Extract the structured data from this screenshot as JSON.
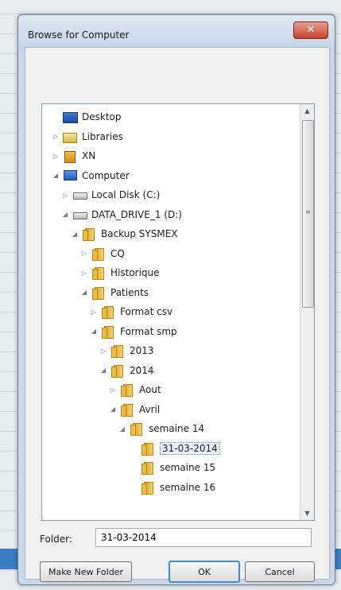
{
  "dialog": {
    "title": "Browse for Computer",
    "close_glyph": "✕",
    "folder_label": "Folder:",
    "folder_value": "31-03-2014",
    "buttons": {
      "new_folder": "Make New Folder",
      "ok": "OK",
      "cancel": "Cancel"
    }
  },
  "tree": [
    {
      "label": "Desktop",
      "icon": "desktop-icon",
      "toggle": ""
    },
    {
      "label": "Libraries",
      "icon": "libraries-icon",
      "toggle": "▷"
    },
    {
      "label": "XN",
      "icon": "user-icon",
      "toggle": "▷"
    },
    {
      "label": "Computer",
      "icon": "computer-icon",
      "toggle": "◢"
    },
    {
      "label": "Local Disk (C:)",
      "icon": "drive-icon",
      "toggle": "▷"
    },
    {
      "label": "DATA_DRIVE_1 (D:)",
      "icon": "drive-icon",
      "toggle": "◢"
    },
    {
      "label": "Backup SYSMEX",
      "icon": "folder-icon",
      "toggle": "◢"
    },
    {
      "label": "CQ",
      "icon": "folder-icon",
      "toggle": "▷"
    },
    {
      "label": "Historique",
      "icon": "folder-icon",
      "toggle": "▷"
    },
    {
      "label": "Patients",
      "icon": "folder-icon",
      "toggle": "◢"
    },
    {
      "label": "Format csv",
      "icon": "folder-icon",
      "toggle": "▷"
    },
    {
      "label": "Format smp",
      "icon": "folder-icon",
      "toggle": "◢"
    },
    {
      "label": "2013",
      "icon": "folder-icon",
      "toggle": "▷"
    },
    {
      "label": "2014",
      "icon": "folder-icon",
      "toggle": "◢"
    },
    {
      "label": "Aout",
      "icon": "folder-icon",
      "toggle": "▷"
    },
    {
      "label": "Avril",
      "icon": "folder-icon",
      "toggle": "◢"
    },
    {
      "label": "semaine 14",
      "icon": "folder-icon",
      "toggle": "◢"
    },
    {
      "label": "31-03-2014",
      "icon": "folder-icon",
      "toggle": "",
      "selected": true
    },
    {
      "label": "semaine 15",
      "icon": "folder-icon",
      "toggle": ""
    },
    {
      "label": "semaine 16",
      "icon": "folder-icon",
      "toggle": ""
    }
  ],
  "scrollbar": {
    "up": "▲",
    "down": "▼",
    "grip": "≡"
  }
}
